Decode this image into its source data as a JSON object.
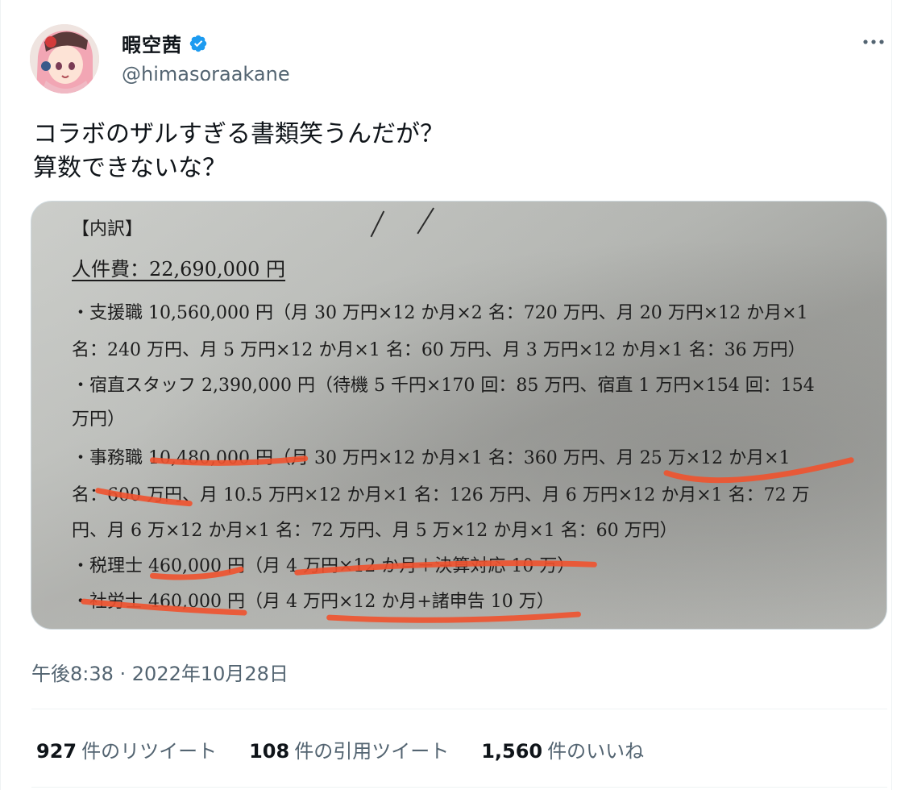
{
  "user": {
    "display_name": "暇空茜",
    "handle": "@himasoraakane",
    "verified": true,
    "verified_color": "#1d9bf0"
  },
  "tweet": {
    "text_lines": [
      "コラボのザルすぎる書類笑うんだが？",
      "算数できないな？"
    ],
    "timestamp": "午後8:38 · 2022年10月28日"
  },
  "media": {
    "lines": {
      "heading": "【内訳】",
      "personnel": "人件費：22,690,000 円",
      "support_1": "・支援職 10,560,000 円（月 30 万円×12 か月×2 名：720 万円、月 20 万円×12 か月×1",
      "support_2": "名：240 万円、月 5 万円×12 か月×1 名：60 万円、月 3 万円×12 か月×1 名：36 万円）",
      "night_1": "・宿直スタッフ 2,390,000 円（待機 5 千円×170 回：85 万円、宿直 1 万円×154 回：154",
      "night_2": "万円）",
      "office_1": "・事務職 10,480,000 円（月 30 万円×12 か月×1 名：360 万円、月 25 万×12 か月×1",
      "office_2": "名：600 万円、月 10.5 万円×12 か月×1 名：126 万円、月 6 万円×12 か月×1 名：72 万",
      "office_3": "円、月 6 万×12 か月×1 名：72 万円、月 5 万×12 か月×1 名：60 万円）",
      "tax": "・税理士 460,000 円（月 4 万円×12 か月＋決算対応 10 万）",
      "labor": "・社労士 460,000 円（月 4 万円×12 か月+諸申告 10 万）"
    },
    "marker_color": "#f0522e"
  },
  "stats": [
    {
      "count": "927",
      "label": "件のリツイート"
    },
    {
      "count": "108",
      "label": "件の引用ツイート"
    },
    {
      "count": "1,560",
      "label": "件のいいね"
    }
  ],
  "icons": {
    "more": "more-options-icon",
    "verified": "verified-badge-icon"
  }
}
